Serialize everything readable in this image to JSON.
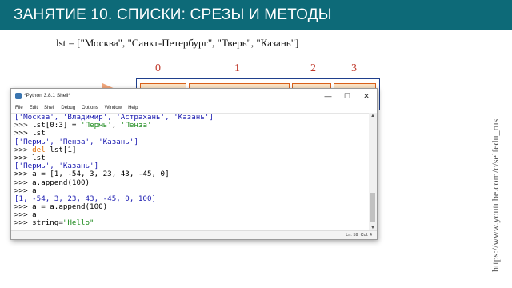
{
  "slide": {
    "title": "ЗАНЯТИЕ 10. СПИСКИ: СРЕЗЫ И МЕТОДЫ",
    "lst_line": "lst = [\"Москва\", \"Санкт-Петербург\", \"Тверь\", \"Казань\"]",
    "indices": [
      "0",
      "1",
      "2",
      "3"
    ],
    "side_url": "https://www.youtube.com/c/selfedu_rus",
    "accent": "#0d6a78"
  },
  "window": {
    "title": "*Python 3.8.1 Shell*",
    "menu": [
      "File",
      "Edit",
      "Shell",
      "Debug",
      "Options",
      "Window",
      "Help"
    ],
    "minimize": "—",
    "maximize": "☐",
    "close": "✕",
    "status_line": "Ln: 59",
    "status_col": "Col: 4"
  },
  "shell": {
    "l1": "['Москва', 'Владимир', 'Астрахань', 'Казань']",
    "l2_prompt": ">>> ",
    "l2_code": "lst[0:3] = ",
    "l2_s1": "'Пермь'",
    "l2_sep": ", ",
    "l2_s2": "'Пенза'",
    "l3": ">>> lst",
    "l4": "['Пермь', 'Пенза', 'Казань']",
    "l5_prompt": ">>> ",
    "l5_kw": "del",
    "l5_rest": " lst[1]",
    "l6": ">>> lst",
    "l7": "['Пермь', 'Казань']",
    "l8": ">>> a = [1, -54, 3, 23, 43, -45, 0]",
    "l9": ">>> a.append(100)",
    "l10": ">>> a",
    "l11": "[1, -54, 3, 23, 43, -45, 0, 100]",
    "l12": ">>> a = a.append(100)",
    "l13": ">>> a",
    "l14_prompt": ">>> string=",
    "l14_str": "\"Hello\""
  }
}
